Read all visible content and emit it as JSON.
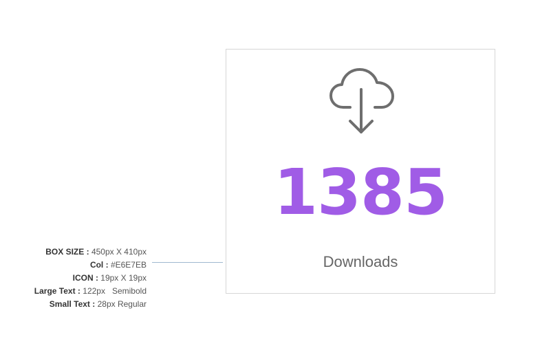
{
  "spec": [
    {
      "key": "BOX SIZE",
      "value": "450px X 410px"
    },
    {
      "key": "Col",
      "value": "#E6E7EB"
    },
    {
      "key": "ICON",
      "value": "19px X 19px"
    },
    {
      "key": "Large Text",
      "value": "122px   Semibold"
    },
    {
      "key": "Small Text",
      "value": "28px Regular"
    }
  ],
  "card": {
    "icon": "cloud-download-icon",
    "number": "1385",
    "label": "Downloads",
    "number_color": "#A05CE6",
    "icon_color": "#6E6E6E"
  }
}
